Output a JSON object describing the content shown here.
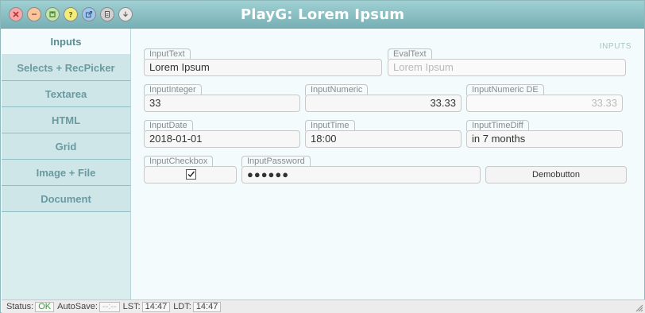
{
  "window": {
    "title": "PlayG: Lorem Ipsum"
  },
  "titlebar_buttons": [
    {
      "icon": "close-icon",
      "color": "#f7a8a8"
    },
    {
      "icon": "minimize-icon",
      "color": "#f7c79a"
    },
    {
      "icon": "save-icon",
      "color": "#bfe7a5"
    },
    {
      "icon": "help-icon",
      "color": "#f2ec7a"
    },
    {
      "icon": "popout-icon",
      "color": "#9fc6ee"
    },
    {
      "icon": "document-icon",
      "color": "#d0d0d0"
    },
    {
      "icon": "download-icon",
      "color": "#e6e6e6"
    }
  ],
  "sidebar": {
    "items": [
      {
        "label": "Inputs",
        "active": true
      },
      {
        "label": "Selects + RecPicker"
      },
      {
        "label": "Textarea"
      },
      {
        "label": "HTML"
      },
      {
        "label": "Grid"
      },
      {
        "label": "Image + File"
      },
      {
        "label": "Document"
      }
    ]
  },
  "main": {
    "section_label": "INPUTS",
    "fields": {
      "input_text": {
        "label": "InputText",
        "value": "Lorem Ipsum"
      },
      "eval_text": {
        "label": "EvalText",
        "value": "Lorem Ipsum"
      },
      "input_integer": {
        "label": "InputInteger",
        "value": "33"
      },
      "input_numeric": {
        "label": "InputNumeric",
        "value": "33.33"
      },
      "input_numeric_de": {
        "label": "InputNumeric DE",
        "value": "33.33"
      },
      "input_date": {
        "label": "InputDate",
        "value": "2018-01-01"
      },
      "input_time": {
        "label": "InputTime",
        "value": "18:00"
      },
      "input_time_diff": {
        "label": "InputTimeDiff",
        "value": "in 7 months"
      },
      "input_checkbox": {
        "label": "InputCheckbox",
        "checked": true
      },
      "input_password": {
        "label": "InputPassword",
        "value": "●●●●●●"
      }
    },
    "demo_button": "Demobutton"
  },
  "statusbar": {
    "status_label": "Status:",
    "status_value": "OK",
    "autosave_label": "AutoSave:",
    "autosave_value": "--:--",
    "lst_label": "LST:",
    "lst_value": "14:47",
    "ldt_label": "LDT:",
    "ldt_value": "14:47"
  }
}
